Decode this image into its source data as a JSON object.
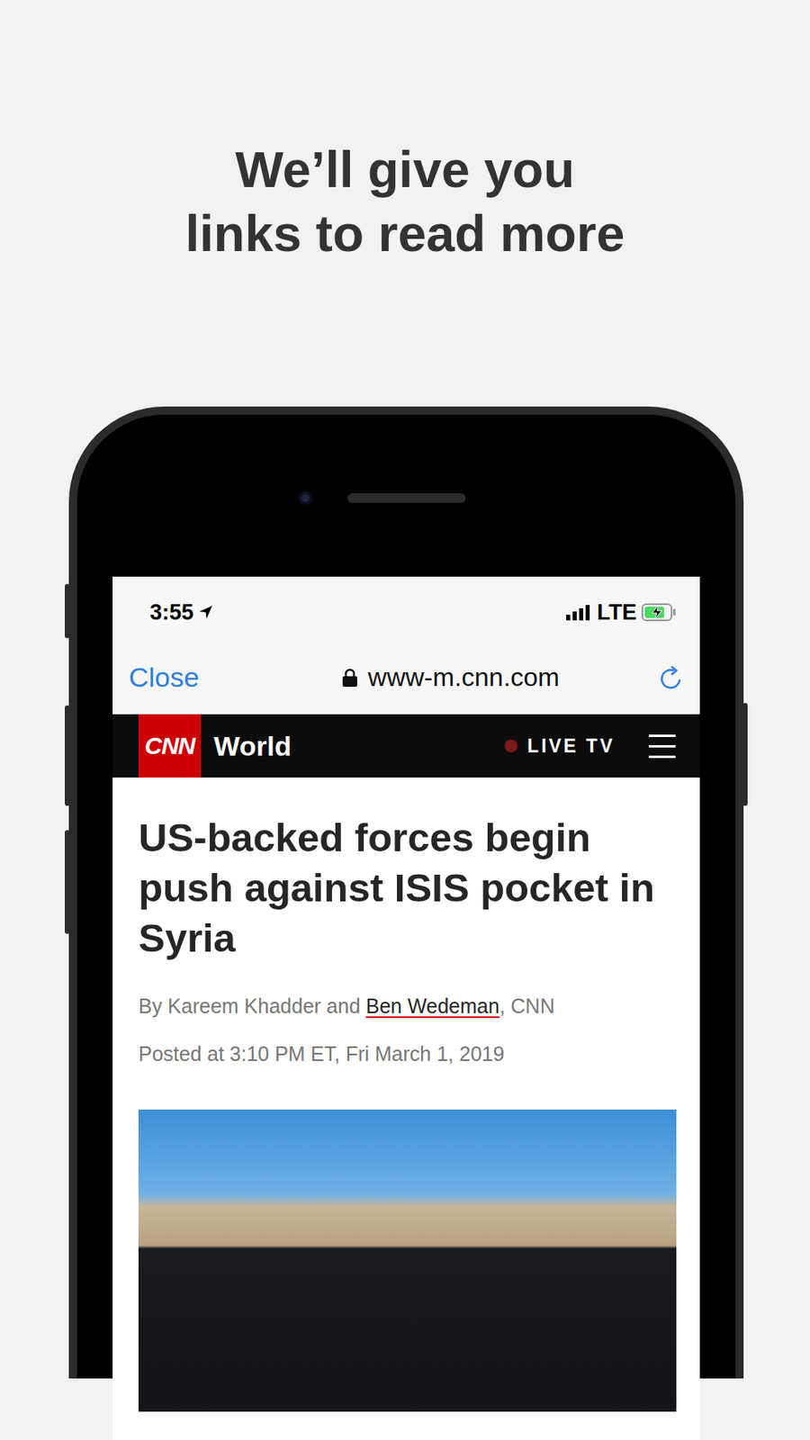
{
  "heading": [
    "We’ll give you",
    "links to read more"
  ],
  "status_bar": {
    "time": "3:55",
    "network": "LTE",
    "battery": {
      "level": 0.8,
      "charging": true
    }
  },
  "browser": {
    "close": "Close",
    "url": "www-m.cnn.com"
  },
  "site_nav": {
    "logo": "CNN",
    "section": "World",
    "live": "LIVE TV"
  },
  "article": {
    "headline": "US-backed forces begin push against ISIS pocket in Syria",
    "byline_prefix": "By Kareem Khadder and ",
    "author_link": "Ben Wedeman",
    "byline_suffix": ", CNN",
    "posted": "Posted at 3:10 PM ET, Fri March 1, 2019"
  }
}
